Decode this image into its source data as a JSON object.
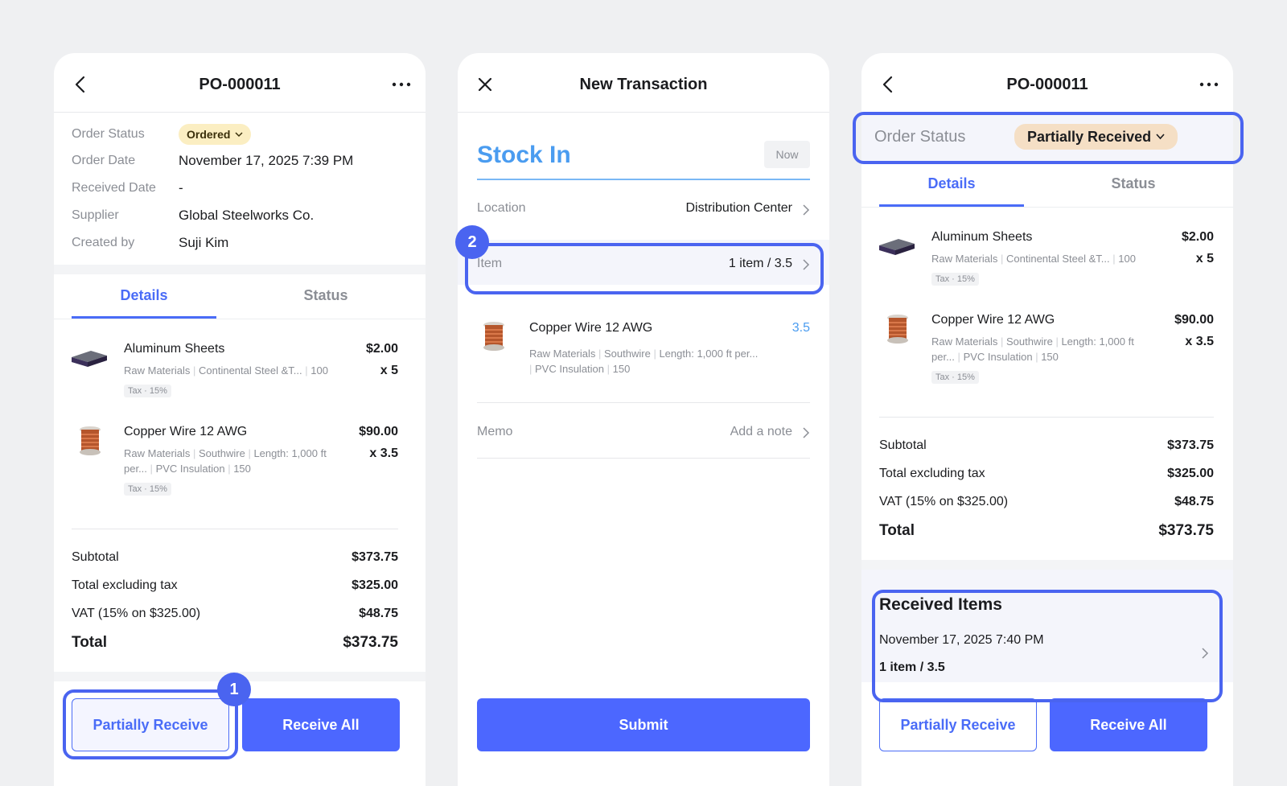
{
  "colors": {
    "accent": "#4a6cf7",
    "button": "#4c67ff",
    "highlight": "#4a64f0",
    "ordered_badge": "#fbeec2",
    "partial_badge": "#f5dfc5"
  },
  "screen1": {
    "title": "PO-000011",
    "info": [
      {
        "label": "Order Status",
        "value": "Ordered"
      },
      {
        "label": "Order Date",
        "value": "November 17, 2025 7:39 PM"
      },
      {
        "label": "Received Date",
        "value": "-"
      },
      {
        "label": "Supplier",
        "value": "Global Steelworks Co."
      },
      {
        "label": "Created by",
        "value": "Suji Kim"
      }
    ],
    "tabs": [
      "Details",
      "Status"
    ],
    "items": [
      {
        "name": "Aluminum Sheets",
        "meta1": "Raw Materials",
        "meta2": "Continental Steel &T...",
        "meta3": "100",
        "tax": "Tax · 15%",
        "price": "$2.00",
        "qty": "x 5",
        "thumb": "aluminum-sheet"
      },
      {
        "name": "Copper Wire 12 AWG",
        "meta1": "Raw Materials",
        "meta2": "Southwire",
        "meta3": "Length: 1,000 ft",
        "meta4": "per...",
        "meta5": "PVC Insulation",
        "meta6": "150",
        "tax": "Tax · 15%",
        "price": "$90.00",
        "qty": "x 3.5",
        "thumb": "copper-spool"
      }
    ],
    "summary": [
      {
        "label": "Subtotal",
        "value": "$373.75"
      },
      {
        "label": "Total excluding tax",
        "value": "$325.00"
      },
      {
        "label": "VAT (15% on $325.00)",
        "value": "$48.75"
      }
    ],
    "total": {
      "label": "Total",
      "value": "$373.75"
    },
    "buttons": {
      "partial": "Partially Receive",
      "all": "Receive All"
    },
    "step": "1"
  },
  "screen2": {
    "title": "New Transaction",
    "heading": "Stock In",
    "time_chip": "Now",
    "location": {
      "label": "Location",
      "value": "Distribution Center"
    },
    "item_row": {
      "label": "Item",
      "value": "1 item / 3.5"
    },
    "item": {
      "name": "Copper Wire 12 AWG",
      "qty": "3.5",
      "meta1": "Raw Materials",
      "meta2": "Southwire",
      "meta3": "Length: 1,000 ft per...",
      "meta4": "PVC Insulation",
      "meta5": "150",
      "thumb": "copper-spool"
    },
    "memo": {
      "label": "Memo",
      "value": "Add a note"
    },
    "submit": "Submit",
    "step": "2"
  },
  "screen3": {
    "title": "PO-000011",
    "status_label": "Order Status",
    "status_value": "Partially Received",
    "tabs": [
      "Details",
      "Status"
    ],
    "items": [
      {
        "name": "Aluminum Sheets",
        "meta1": "Raw Materials",
        "meta2": "Continental Steel &T...",
        "meta3": "100",
        "tax": "Tax · 15%",
        "price": "$2.00",
        "qty": "x 5"
      },
      {
        "name": "Copper Wire 12 AWG",
        "meta1": "Raw Materials",
        "meta2": "Southwire",
        "meta3": "Length: 1,000 ft",
        "meta4": "per...",
        "meta5": "PVC Insulation",
        "meta6": "150",
        "tax": "Tax · 15%",
        "price": "$90.00",
        "qty": "x 3.5"
      }
    ],
    "summary": [
      {
        "label": "Subtotal",
        "value": "$373.75"
      },
      {
        "label": "Total excluding tax",
        "value": "$325.00"
      },
      {
        "label": "VAT (15% on $325.00)",
        "value": "$48.75"
      }
    ],
    "total": {
      "label": "Total",
      "value": "$373.75"
    },
    "received": {
      "title": "Received Items",
      "date": "November 17, 2025 7:40 PM",
      "summary": "1 item / 3.5"
    },
    "buttons": {
      "partial": "Partially Receive",
      "all": "Receive All"
    }
  }
}
